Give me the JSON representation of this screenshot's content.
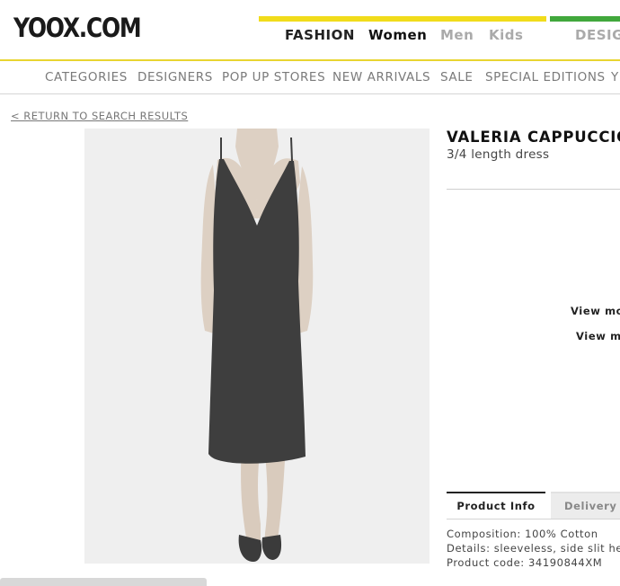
{
  "header": {
    "logo": "YOOX.COM",
    "nav": {
      "fashion": "FASHION",
      "women": "Women",
      "men": "Men",
      "kids": "Kids",
      "designers": "DESIG"
    }
  },
  "categories": [
    "CATEGORIES",
    "DESIGNERS",
    "POP UP STORES",
    "NEW ARRIVALS",
    "SALE",
    "SPECIAL EDITIONS",
    "Y"
  ],
  "return_link": "< RETURN TO SEARCH RESULTS",
  "product": {
    "brand": "VALERIA CAPPUCCIO",
    "name": "3/4 length dress",
    "view_more_1": "View mo",
    "view_more_2": "View mo",
    "tabs": {
      "info": "Product Info",
      "delivery": "Delivery &"
    },
    "composition": "Composition:  100% Cotton",
    "details": "Details:  sleeveless, side slit hem",
    "code": "Product code: 34190844XM"
  },
  "colors": {
    "yellow": "#f1dc1b",
    "green": "#41a83c",
    "dress": "#3c3c3c"
  }
}
